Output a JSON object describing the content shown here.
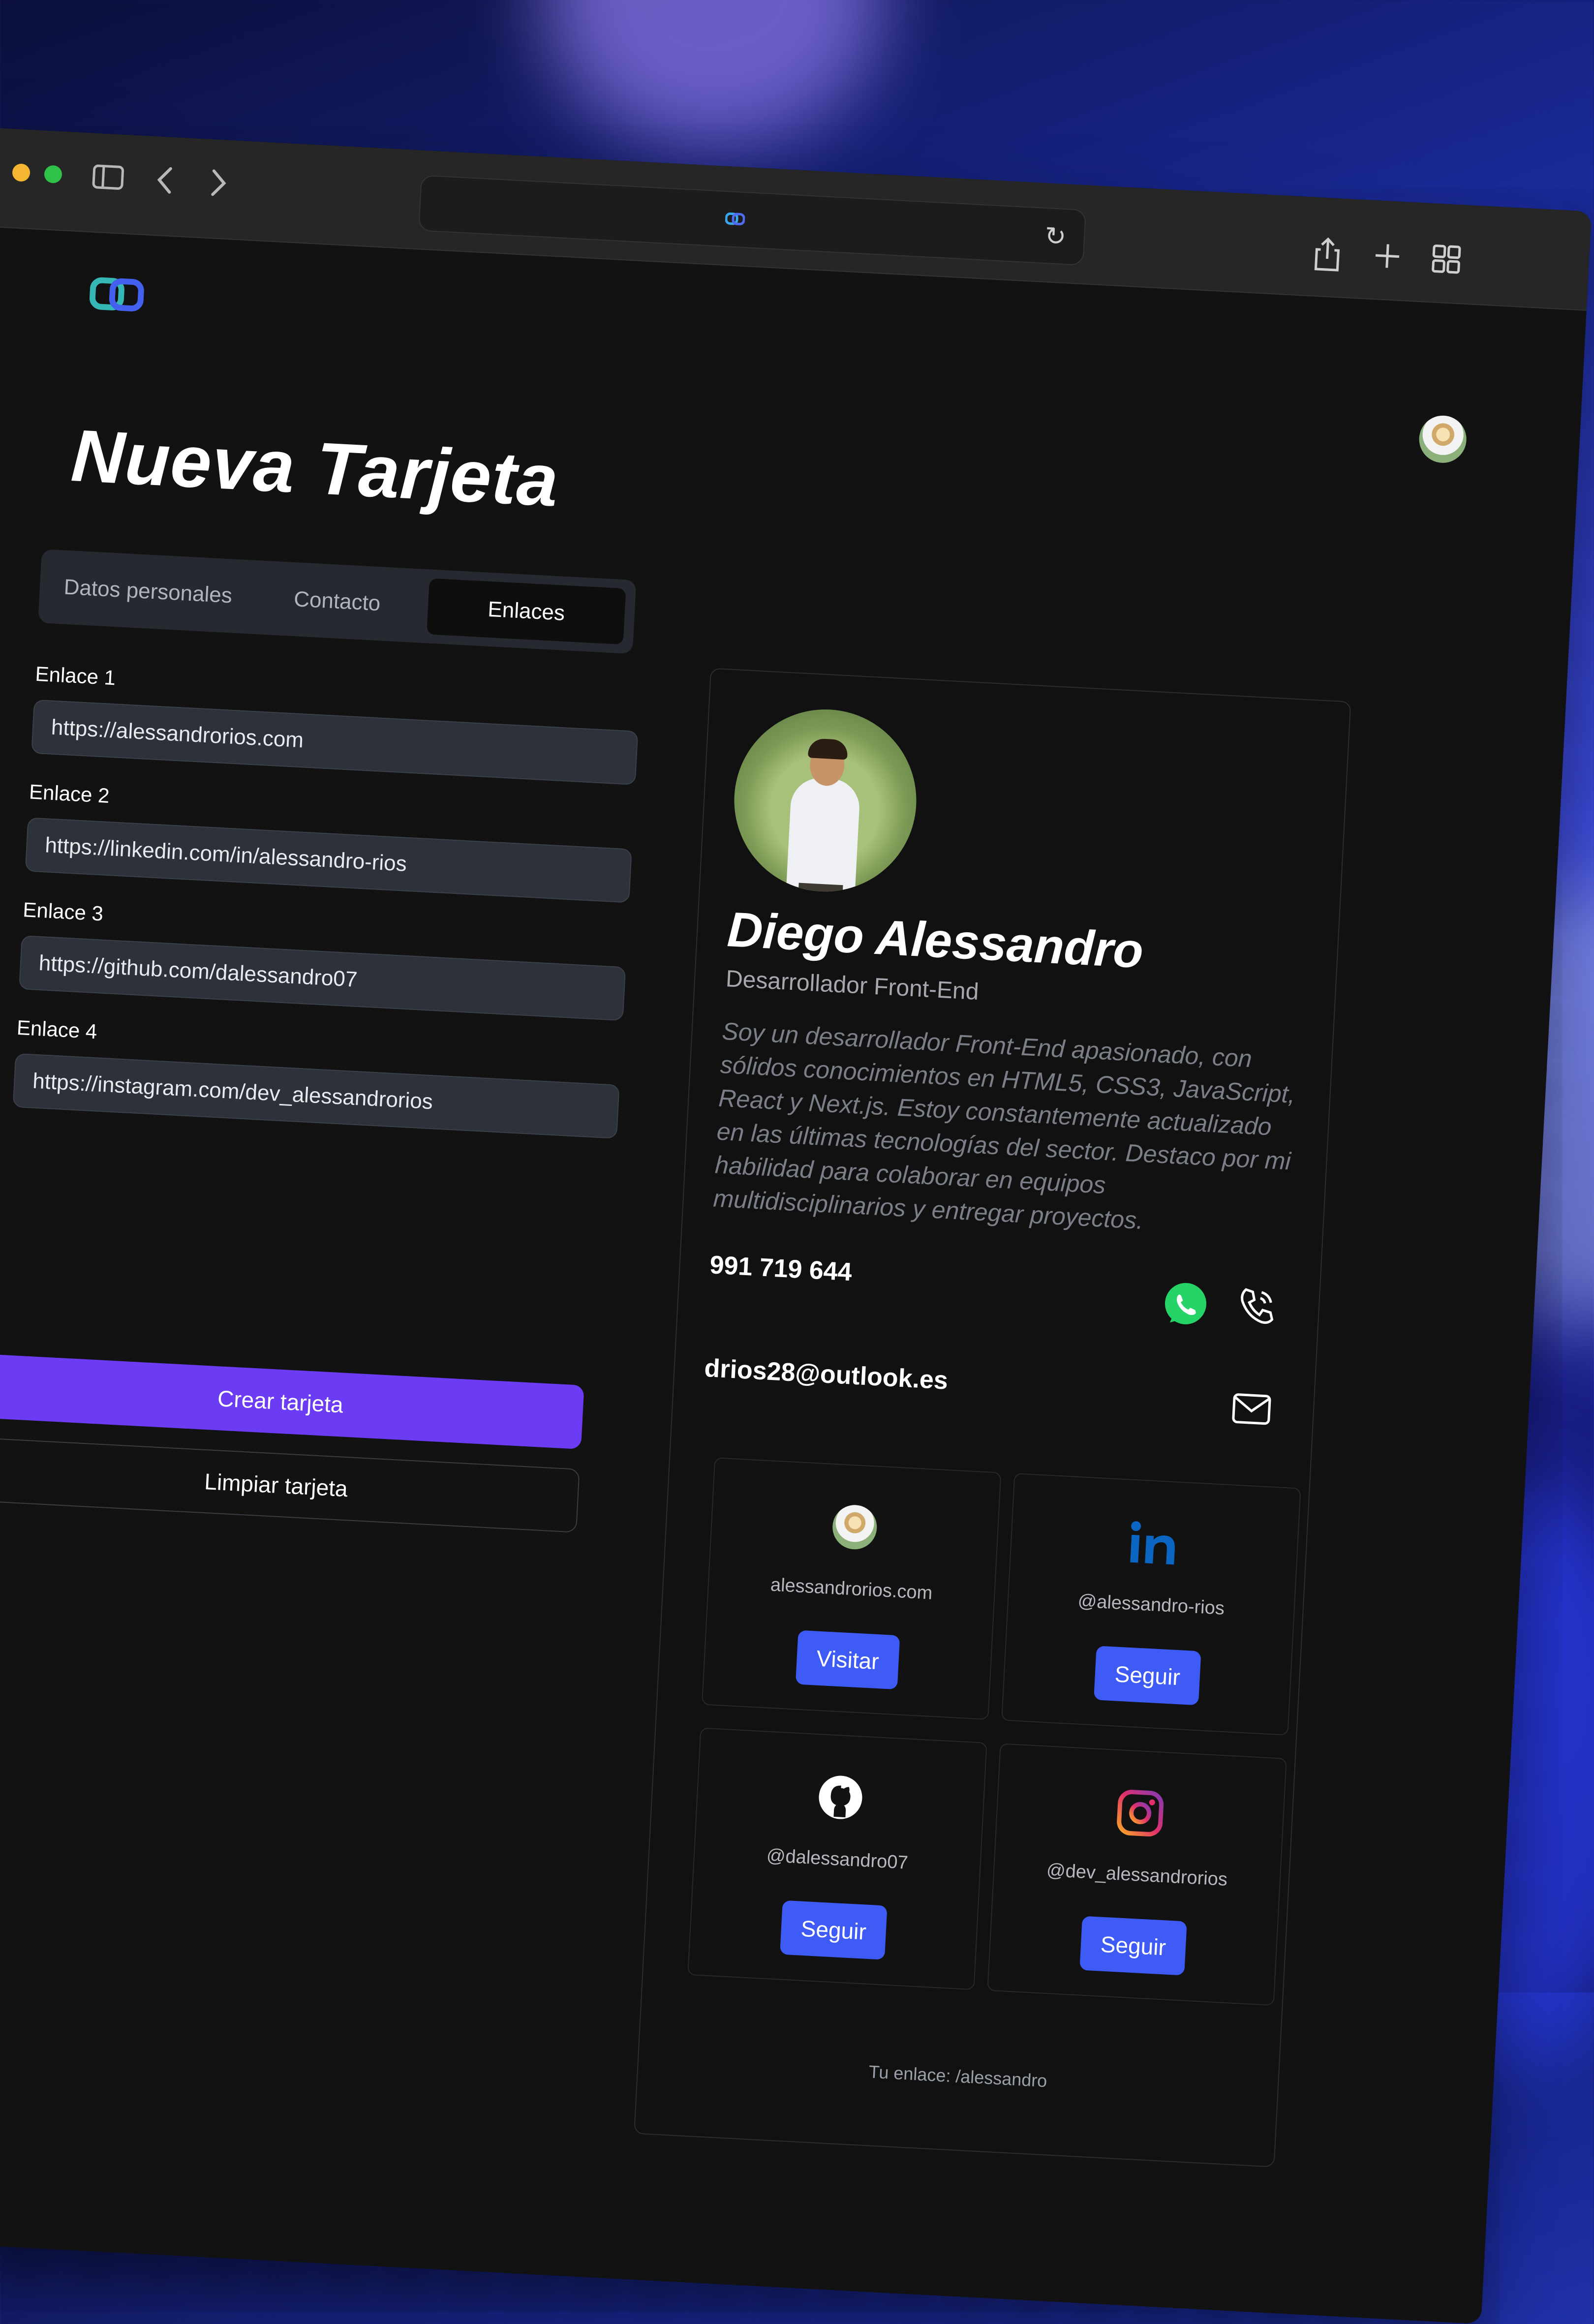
{
  "browser": {
    "url_display": ""
  },
  "page": {
    "title": "Nueva Tarjeta"
  },
  "tabs": [
    {
      "label": "Datos personales",
      "active": false
    },
    {
      "label": "Contacto",
      "active": false
    },
    {
      "label": "Enlaces",
      "active": true
    }
  ],
  "links": [
    {
      "label": "Enlace 1",
      "value": "https://alessandrorios.com"
    },
    {
      "label": "Enlace 2",
      "value": "https://linkedin.com/in/alessandro-rios"
    },
    {
      "label": "Enlace 3",
      "value": "https://github.com/dalessandro07"
    },
    {
      "label": "Enlace 4",
      "value": "https://instagram.com/dev_alessandrorios"
    }
  ],
  "buttons": {
    "create": "Crear tarjeta",
    "clear": "Limpiar tarjeta"
  },
  "card": {
    "name": "Diego Alessandro",
    "role": "Desarrollador Front-End",
    "bio": "Soy un desarrollador Front-End apasionado, con sólidos conocimientos en HTML5, CSS3, JavaScript, React y Next.js. Estoy constantemente actualizado en las últimas tecnologías del sector. Destaco por mi habilidad para colaborar en equipos multidisciplinarios y entregar proyectos.",
    "phone": "991 719 644",
    "email": "drios28@outlook.es",
    "link_cards": [
      {
        "icon": "avatar-icon",
        "text": "alessandrorios.com",
        "button": "Visitar"
      },
      {
        "icon": "linkedin-icon",
        "text": "@alessandro-rios",
        "button": "Seguir"
      },
      {
        "icon": "github-icon",
        "text": "@dalessandro07",
        "button": "Seguir"
      },
      {
        "icon": "instagram-icon",
        "text": "@dev_alessandrorios",
        "button": "Seguir"
      }
    ],
    "footer": "Tu enlace: /alessandro"
  },
  "colors": {
    "accent_primary": "#6c3cf5",
    "accent_button": "#3f5bf6",
    "background": "#121212",
    "whatsapp": "#25d366",
    "linkedin": "#0a66c2"
  }
}
